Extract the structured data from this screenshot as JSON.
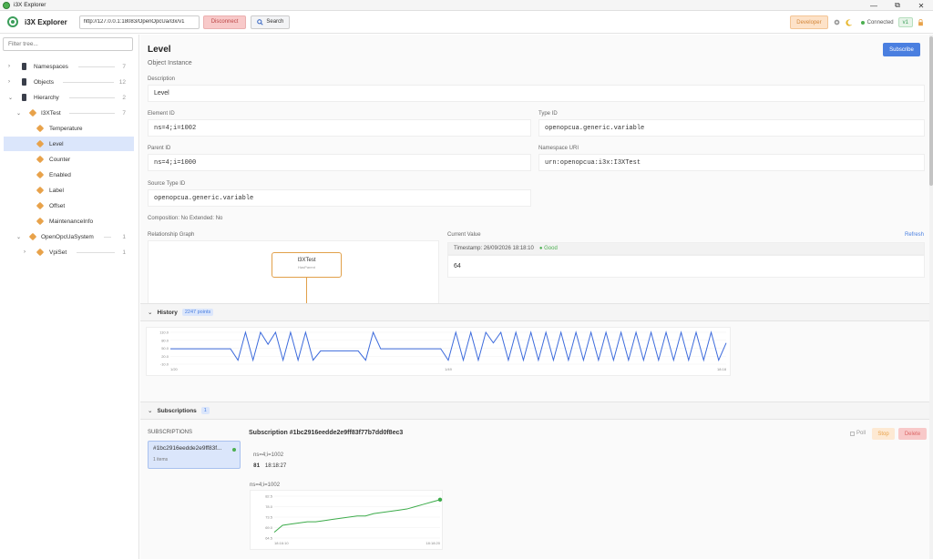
{
  "window": {
    "title": "i3X Explorer",
    "minimize": "—",
    "restore": "⧉",
    "close": "✕"
  },
  "toolbar": {
    "brand": "i3X Explorer",
    "server_url": "http://127.0.0.1:18083/OpenOpcUa/i3x/v1",
    "disconnect_label": "Disconnect",
    "search_label": "Search",
    "developer_label": "Developer",
    "status_label": "Connected",
    "version_label": "v1"
  },
  "sidebar": {
    "filter_placeholder": "Filter tree...",
    "items": [
      {
        "label": "Namespaces",
        "count": "7",
        "chev": "›",
        "icon": "database-icon"
      },
      {
        "label": "Objects",
        "count": "12",
        "chev": "›",
        "icon": "database-icon"
      },
      {
        "label": "Hierarchy",
        "count": "2",
        "chev": "⌄",
        "icon": "database-icon"
      },
      {
        "label": "I3XTest",
        "count": "7",
        "chev": "⌄",
        "icon": "cube-icon"
      },
      {
        "label": "Temperature",
        "icon": "cube-icon"
      },
      {
        "label": "Level",
        "icon": "cube-icon"
      },
      {
        "label": "Counter",
        "icon": "cube-icon"
      },
      {
        "label": "Enabled",
        "icon": "cube-icon"
      },
      {
        "label": "Label",
        "icon": "cube-icon"
      },
      {
        "label": "Offset",
        "icon": "cube-icon"
      },
      {
        "label": "MaintenanceInfo",
        "icon": "cube-icon"
      },
      {
        "label": "OpenOpcUaSystem",
        "count": "1",
        "chev": "⌄",
        "icon": "cube-icon"
      },
      {
        "label": "VpiSet",
        "count": "1",
        "chev": "›",
        "icon": "cube-icon"
      }
    ]
  },
  "detail": {
    "title": "Level",
    "subtitle": "Object Instance",
    "subscribe_label": "Subscribe",
    "description_label": "Description",
    "description": "Level",
    "element_id_label": "Element ID",
    "element_id": "ns=4;i=1002",
    "type_id_label": "Type ID",
    "type_id": "openopcua.generic.variable",
    "parent_id_label": "Parent ID",
    "parent_id": "ns=4;i=1000",
    "namespace_uri_label": "Namespace URI",
    "namespace_uri": "urn:openopcua:i3x:I3XTest",
    "source_type_id_label": "Source Type ID",
    "source_type_id": "openopcua.generic.variable",
    "composition": "Composition: No    Extended: No",
    "relationship_label": "Relationship Graph",
    "graph_node": "I3XTest",
    "graph_edge_label": "HasParent",
    "current_value_label": "Current Value",
    "refresh_label": "Refresh",
    "timestamp": "Timestamp: 26/09/2026 18:18:10",
    "quality": "● Good",
    "current_value": "64"
  },
  "history": {
    "label": "History",
    "points_badge": "2247 points",
    "chevron": "⌄"
  },
  "subscriptions": {
    "label": "Subscriptions",
    "count_badge": "1",
    "chevron": "⌄",
    "list_header": "SUBSCRIPTIONS",
    "card_id": "#1bc2916eedde2e9ff83f...",
    "card_items": "1 items",
    "title": "Subscription #1bc2916eedde2e9ff83f77b7dd0f8ec3",
    "poll_label": "Poll",
    "stop_label": "Stop",
    "delete_label": "Delete",
    "node_id": "ns=4;i=1002",
    "item_value": "81",
    "item_time": "18:18:27",
    "chart_node": "ns=4;i=1002"
  },
  "colors": {
    "accent": "#4a7fe0",
    "good": "#4caf50",
    "danger": "#d66",
    "warning": "#e8a24a"
  },
  "chart_data": [
    {
      "type": "line",
      "title": "",
      "series": [
        {
          "values": [
            48,
            48,
            48,
            48,
            48,
            48,
            48,
            48,
            48,
            5,
            110,
            5,
            110,
            65,
            110,
            5,
            110,
            5,
            110,
            5,
            40,
            40,
            40,
            40,
            40,
            40,
            5,
            110,
            48,
            48,
            48,
            48,
            48,
            48,
            48,
            48,
            48,
            5,
            110,
            5,
            110,
            5,
            110,
            70,
            110,
            5,
            110,
            5,
            110,
            5,
            110,
            5,
            110,
            5,
            110,
            5,
            110,
            5,
            110,
            5,
            110,
            5,
            110,
            5,
            110,
            5,
            110,
            5,
            110,
            5,
            110,
            5,
            110,
            5,
            70
          ]
        }
      ],
      "y_ticks": [
        "110.0",
        "80.0",
        "50.0",
        "20.0",
        "-10.0"
      ],
      "x_ticks": [
        "1/20",
        "1/49",
        "18:18"
      ],
      "ylim": [
        -10,
        110
      ]
    },
    {
      "type": "line",
      "title": "",
      "series": [
        {
          "values": [
            67,
            70,
            70.5,
            71,
            71.5,
            71.5,
            72,
            72.5,
            73,
            73.5,
            74,
            74,
            75,
            75.5,
            76,
            76.5,
            77,
            78,
            79,
            80,
            81
          ]
        }
      ],
      "y_ticks": [
        "82.5",
        "78.0",
        "73.5",
        "69.0",
        "64.5"
      ],
      "x_ticks": [
        "18:16:10",
        "18:18:20"
      ],
      "ylim": [
        64.5,
        82.5
      ]
    }
  ]
}
